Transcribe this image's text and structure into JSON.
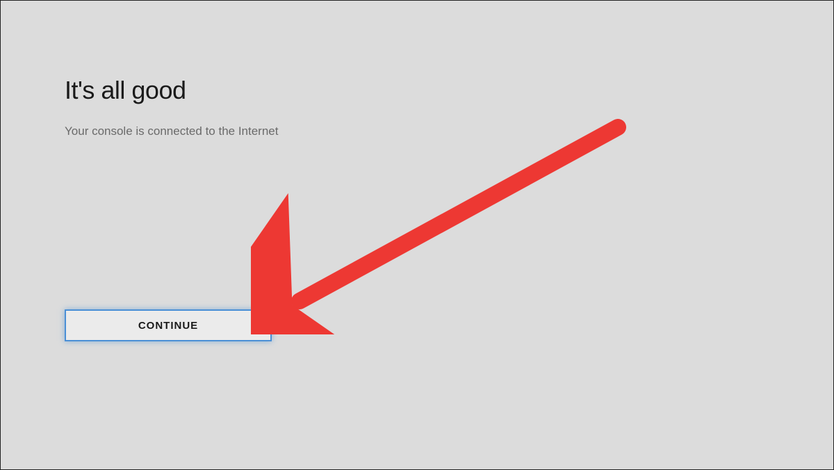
{
  "heading": "It's all good",
  "subtitle": "Your console is connected to the Internet",
  "continue_label": "CONTINUE",
  "annotation": {
    "arrow_color": "#ed3833"
  }
}
